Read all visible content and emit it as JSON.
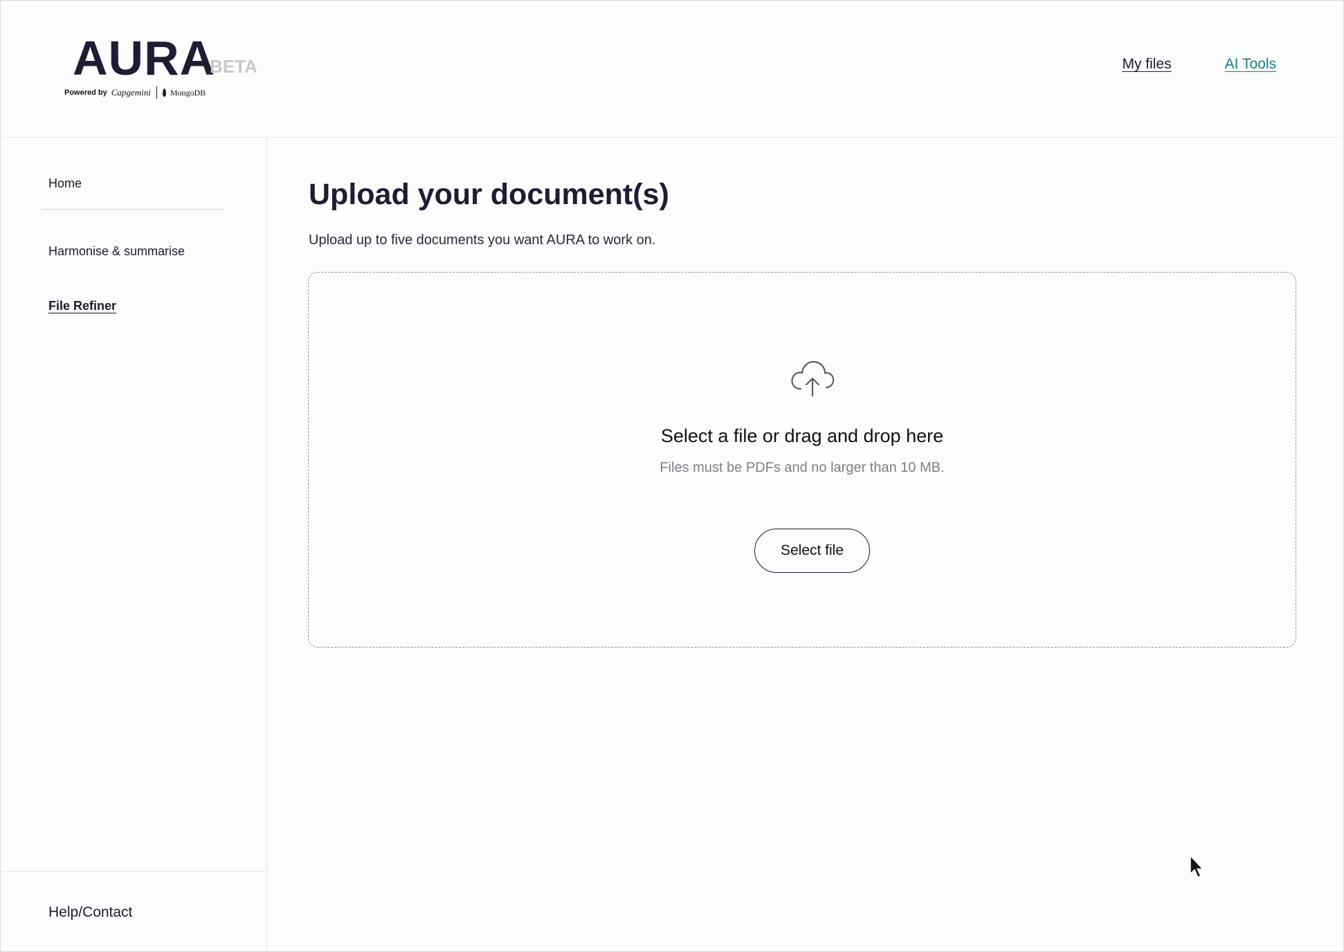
{
  "header": {
    "logo_text": "AURA",
    "logo_badge": "BETA",
    "powered_label": "Powered by",
    "partner_one": "Capgemini",
    "partner_two": "MongoDB",
    "nav": [
      {
        "label": "My files",
        "active": false
      },
      {
        "label": "AI Tools",
        "active": true
      }
    ],
    "active_color": "#137f83"
  },
  "sidebar": {
    "items": [
      {
        "label": "Home"
      },
      {
        "label": "Harmonise & summarise"
      },
      {
        "label": "File Refiner",
        "active": true
      }
    ],
    "footer_label": "Help/Contact"
  },
  "main": {
    "title": "Upload your document(s)",
    "subtitle": "Upload up to five documents you want AURA to work on.",
    "dropzone": {
      "icon": "cloud-upload-icon",
      "title": "Select a file or drag and drop here",
      "note": "Files must be PDFs and no larger than 10 MB.",
      "button_label": "Select file"
    }
  }
}
